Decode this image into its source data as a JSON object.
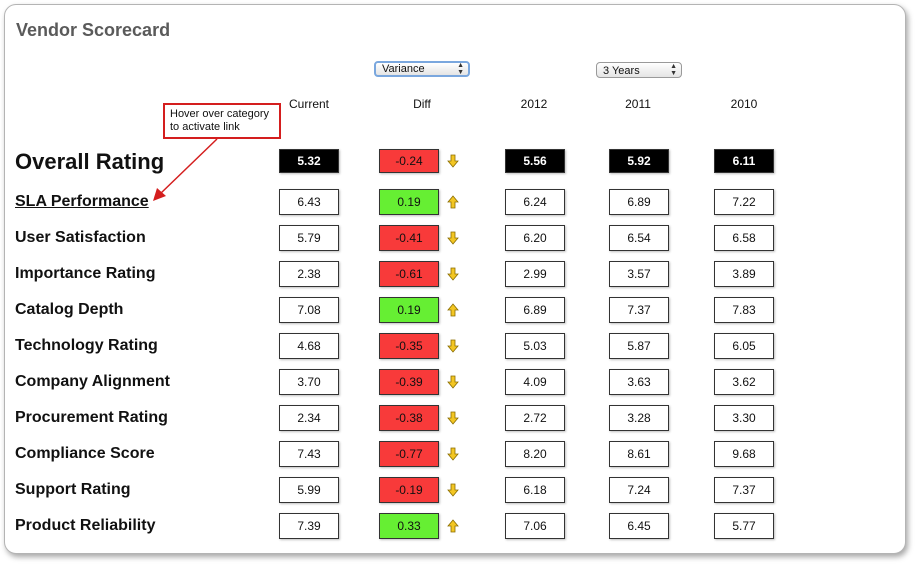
{
  "title": "Vendor Scorecard",
  "controls": {
    "view_select": "Variance",
    "range_select": "3 Years"
  },
  "columns": [
    "Current",
    "Diff",
    "2012",
    "2011",
    "2010"
  ],
  "annotation": {
    "line1": "Hover over category",
    "line2": "to activate link"
  },
  "colors": {
    "negative": "#f83a3a",
    "positive": "#66ef33",
    "overall_bg": "#000000",
    "arrow": "#f3c623"
  },
  "rows": [
    {
      "label": "Overall Rating",
      "current": "5.32",
      "diff": "-0.24",
      "trend": "down",
      "y2012": "5.56",
      "y2011": "5.92",
      "y2010": "6.11"
    },
    {
      "label": "SLA Performance",
      "current": "6.43",
      "diff": "0.19",
      "trend": "up",
      "y2012": "6.24",
      "y2011": "6.89",
      "y2010": "7.22"
    },
    {
      "label": "User Satisfaction",
      "current": "5.79",
      "diff": "-0.41",
      "trend": "down",
      "y2012": "6.20",
      "y2011": "6.54",
      "y2010": "6.58"
    },
    {
      "label": "Importance Rating",
      "current": "2.38",
      "diff": "-0.61",
      "trend": "down",
      "y2012": "2.99",
      "y2011": "3.57",
      "y2010": "3.89"
    },
    {
      "label": "Catalog Depth",
      "current": "7.08",
      "diff": "0.19",
      "trend": "up",
      "y2012": "6.89",
      "y2011": "7.37",
      "y2010": "7.83"
    },
    {
      "label": "Technology Rating",
      "current": "4.68",
      "diff": "-0.35",
      "trend": "down",
      "y2012": "5.03",
      "y2011": "5.87",
      "y2010": "6.05"
    },
    {
      "label": "Company Alignment",
      "current": "3.70",
      "diff": "-0.39",
      "trend": "down",
      "y2012": "4.09",
      "y2011": "3.63",
      "y2010": "3.62"
    },
    {
      "label": "Procurement Rating",
      "current": "2.34",
      "diff": "-0.38",
      "trend": "down",
      "y2012": "2.72",
      "y2011": "3.28",
      "y2010": "3.30"
    },
    {
      "label": "Compliance Score",
      "current": "7.43",
      "diff": "-0.77",
      "trend": "down",
      "y2012": "8.20",
      "y2011": "8.61",
      "y2010": "9.68"
    },
    {
      "label": "Support Rating",
      "current": "5.99",
      "diff": "-0.19",
      "trend": "down",
      "y2012": "6.18",
      "y2011": "7.24",
      "y2010": "7.37"
    },
    {
      "label": "Product Reliability",
      "current": "7.39",
      "diff": "0.33",
      "trend": "up",
      "y2012": "7.06",
      "y2011": "6.45",
      "y2010": "5.77"
    }
  ]
}
